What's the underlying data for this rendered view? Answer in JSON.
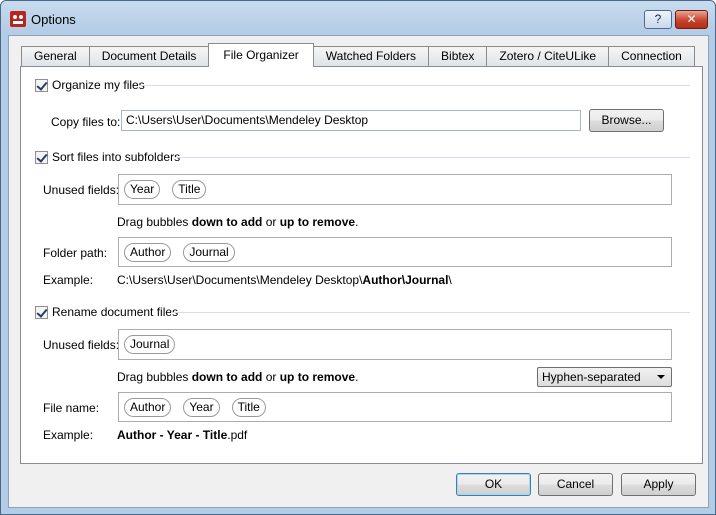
{
  "window": {
    "title": "Options",
    "help_label": "?",
    "close_label": "✕"
  },
  "tabs": [
    {
      "label": "General"
    },
    {
      "label": "Document Details"
    },
    {
      "label": "File Organizer"
    },
    {
      "label": "Watched Folders"
    },
    {
      "label": "Bibtex"
    },
    {
      "label": "Zotero / CiteULike"
    },
    {
      "label": "Connection"
    }
  ],
  "organize": {
    "checkbox_label": "Organize my files",
    "checked": true,
    "copy_label": "Copy files to:",
    "copy_path": "C:\\Users\\User\\Documents\\Mendeley Desktop",
    "browse_label": "Browse..."
  },
  "subfolders": {
    "checkbox_label": "Sort files into subfolders",
    "checked": true,
    "unused_label": "Unused fields:",
    "unused_bubbles": [
      "Year",
      "Title"
    ],
    "hint_prefix": "Drag bubbles ",
    "hint_down": "down to add",
    "hint_mid": " or ",
    "hint_up": "up to remove",
    "hint_suffix": ".",
    "folder_label": "Folder path:",
    "folder_bubbles": [
      "Author",
      "Journal"
    ],
    "example_label": "Example:",
    "example_prefix": "C:\\Users\\User\\Documents\\Mendeley Desktop\\",
    "example_bold": "Author\\Journal",
    "example_suffix": "\\"
  },
  "rename": {
    "checkbox_label": "Rename document files",
    "checked": true,
    "unused_label": "Unused fields:",
    "unused_bubbles": [
      "Journal"
    ],
    "hint_prefix": "Drag bubbles ",
    "hint_down": "down to add",
    "hint_mid": " or ",
    "hint_up": "up to remove",
    "hint_suffix": ".",
    "separator_value": "Hyphen-separated",
    "file_label": "File name:",
    "file_bubbles": [
      "Author",
      "Year",
      "Title"
    ],
    "example_label": "Example:",
    "example_bold": "Author - Year - Title",
    "example_suffix": ".pdf"
  },
  "footer": {
    "ok_label": "OK",
    "cancel_label": "Cancel",
    "apply_label": "Apply"
  }
}
